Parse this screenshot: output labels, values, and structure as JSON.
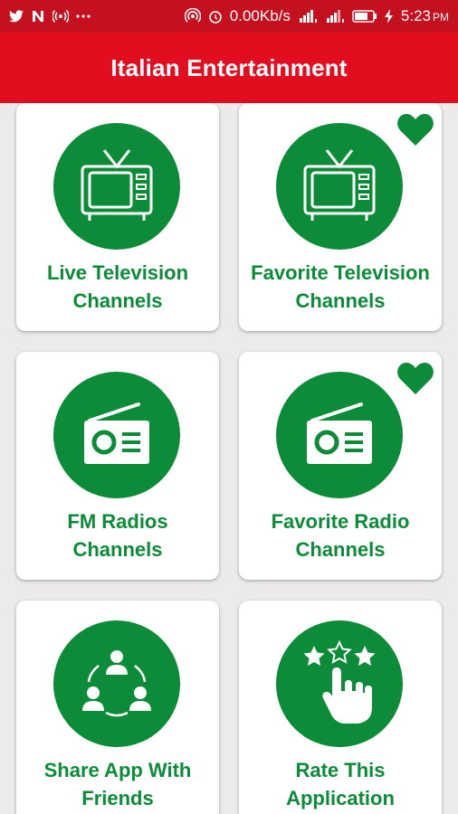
{
  "status_bar": {
    "left_icons": [
      "twitter-icon",
      "n-app-icon",
      "signal-broadcast-icon",
      "more-dots-icon"
    ],
    "right_icons": [
      "hotspot-icon",
      "alarm-icon",
      "sim1-signal-icon",
      "sim2-signal-icon",
      "battery-icon",
      "charging-icon"
    ],
    "network_speed": "0.00Kb/s",
    "time": "5:23",
    "ampm": "PM"
  },
  "app_bar": {
    "title": "Italian Entertainment"
  },
  "theme": {
    "accent": "#0c8b38",
    "header": "#e20e1f",
    "status": "#c5101f",
    "background": "#ecebea"
  },
  "menu": [
    {
      "label": "Live Television\nChannels",
      "icon": "tv-icon",
      "favorite": false
    },
    {
      "label": "Favorite Television\nChannels",
      "icon": "tv-icon",
      "favorite": true
    },
    {
      "label": "FM Radios\nChannels",
      "icon": "radio-icon",
      "favorite": false
    },
    {
      "label": "Favorite Radio\nChannels",
      "icon": "radio-icon",
      "favorite": true
    },
    {
      "label": "Share App With\nFriends",
      "icon": "share-people-icon",
      "favorite": false
    },
    {
      "label": "Rate This\nApplication",
      "icon": "rate-stars-hand-icon",
      "favorite": false
    }
  ]
}
